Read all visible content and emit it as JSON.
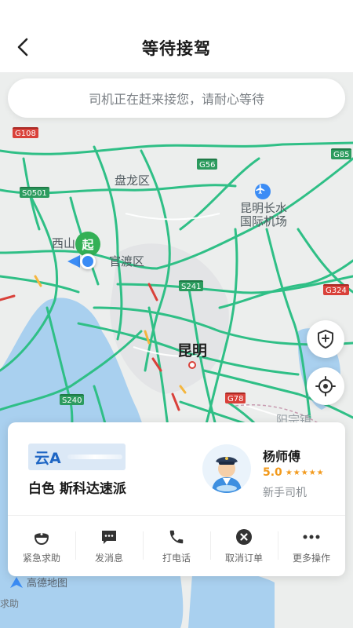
{
  "header": {
    "title": "等待接驾"
  },
  "notice": {
    "text": "司机正在赶来接您，请耐心等待"
  },
  "map": {
    "labels": {
      "panlong": "盘龙区",
      "xishan": "西山",
      "guandu": "官渡区",
      "kunming": "昆明",
      "airport_line1": "昆明长水",
      "airport_line2": "国际机场",
      "yangzong": "阳宗镇"
    },
    "roads": [
      "G108",
      "G56",
      "G85",
      "S0501",
      "S241",
      "G324",
      "S240",
      "G78"
    ],
    "start_marker": "起",
    "provider": "高德地图",
    "help_tab": "求助"
  },
  "driver": {
    "plate_prefix": "云A",
    "car": "白色 斯科达速派",
    "name": "杨师傅",
    "rating": "5.0",
    "stars": "★★★★★",
    "tag": "新手司机"
  },
  "actions": [
    {
      "label": "紧急求助",
      "icon": "police-icon"
    },
    {
      "label": "发消息",
      "icon": "message-icon"
    },
    {
      "label": "打电话",
      "icon": "phone-icon"
    },
    {
      "label": "取消订单",
      "icon": "cancel-icon"
    },
    {
      "label": "更多操作",
      "icon": "more-icon"
    }
  ],
  "colors": {
    "accent": "#33b056",
    "road": "#2fbf86",
    "traffic_red": "#d9413a",
    "rating": "#f29a1d",
    "water": "#a9d0ef"
  }
}
